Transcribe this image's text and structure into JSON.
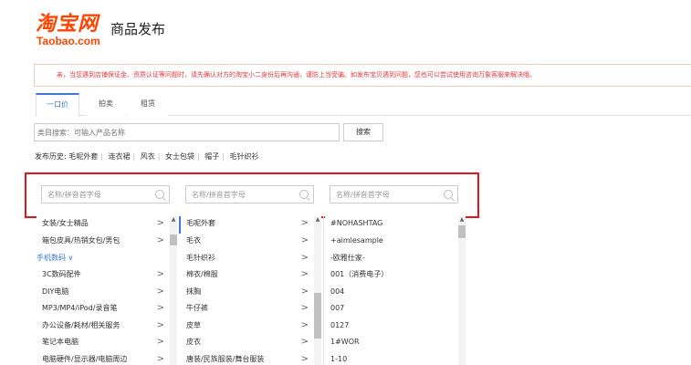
{
  "header": {
    "logo_cn": "淘宝网",
    "logo_en": "Taobao.com",
    "title": "商品发布"
  },
  "notice": {
    "text": "亲，当您遇到店铺保证金、资质认证等问题时，请先确认对方的淘宝小二身份后再沟通，谨防上当受骗。如发布宝贝遇到问题，您也可以尝试使用咨询万象客服来解决哦。"
  },
  "tabs": [
    {
      "label": "一口价",
      "active": true
    },
    {
      "label": "拍卖",
      "active": false
    },
    {
      "label": "租赁",
      "active": false
    }
  ],
  "search": {
    "placeholder": "类目搜索：可输入产品名称",
    "button_label": "搜索"
  },
  "history": {
    "label": "发布历史:",
    "items": [
      "毛呢外套",
      "连衣裙",
      "风衣",
      "女士包袋",
      "帽子",
      "毛针织衫"
    ]
  },
  "columns": {
    "search_placeholder": "名称/拼音首字母",
    "col1": [
      {
        "label": "女装/女士精品",
        "arrow": ">",
        "type": "selected"
      },
      {
        "label": "箱包皮具/热销女包/男包",
        "arrow": ">",
        "type": "item"
      },
      {
        "label": "手机数码 ∨",
        "arrow": "",
        "type": "group"
      },
      {
        "label": "3C数码配件",
        "arrow": ">",
        "type": "item"
      },
      {
        "label": "DIY电脑",
        "arrow": ">",
        "type": "item"
      },
      {
        "label": "MP3/MP4/iPod/录音笔",
        "arrow": ">",
        "type": "item"
      },
      {
        "label": "办公设备/耗材/相关服务",
        "arrow": ">",
        "type": "item"
      },
      {
        "label": "笔记本电脑",
        "arrow": ">",
        "type": "item"
      },
      {
        "label": "电脑硬件/显示器/电脑周边",
        "arrow": ">",
        "type": "item"
      }
    ],
    "col2": [
      {
        "label": "毛呢外套",
        "arrow": ">"
      },
      {
        "label": "毛衣",
        "arrow": ">"
      },
      {
        "label": "毛针织衫",
        "arrow": ">"
      },
      {
        "label": "棉衣/棉服",
        "arrow": ">"
      },
      {
        "label": "抹胸",
        "arrow": ">"
      },
      {
        "label": "牛仔裤",
        "arrow": ">"
      },
      {
        "label": "皮草",
        "arrow": ">"
      },
      {
        "label": "皮衣",
        "arrow": ">"
      },
      {
        "label": "唐装/民族服装/舞台服装",
        "arrow": ">"
      }
    ],
    "col3": [
      {
        "label": "#NOHASHTAG"
      },
      {
        "label": "+aimlesample"
      },
      {
        "label": "-欧雅仕家-"
      },
      {
        "label": "001（消费电子）"
      },
      {
        "label": "004"
      },
      {
        "label": "007"
      },
      {
        "label": "0127"
      },
      {
        "label": "1#WOR"
      },
      {
        "label": "1-10"
      }
    ]
  },
  "colors": {
    "brand": "#ff4400",
    "accent": "#3b78d8",
    "notice_text": "#e4393c",
    "highlight": "#e0161c"
  }
}
